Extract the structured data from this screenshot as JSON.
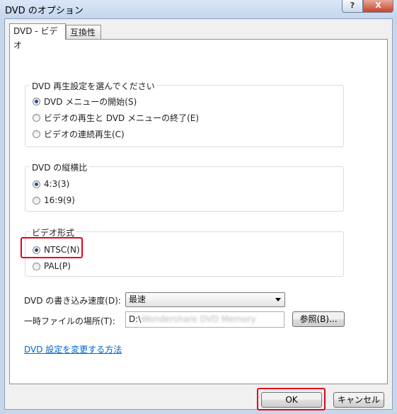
{
  "window": {
    "title": "DVD のオプション",
    "help_label": "?",
    "close_label": "X"
  },
  "tabs": [
    {
      "label": "DVD - ビデオ",
      "active": true
    },
    {
      "label": "互換性",
      "active": false
    }
  ],
  "playback_group": {
    "title": "DVD 再生設定を選んでください",
    "options": [
      {
        "label": "DVD メニューの開始(S)",
        "selected": true
      },
      {
        "label": "ビデオの再生と DVD メニューの終了(E)",
        "selected": false
      },
      {
        "label": "ビデオの連続再生(C)",
        "selected": false
      }
    ]
  },
  "aspect_group": {
    "title": "DVD の縦横比",
    "options": [
      {
        "label": "4:3(3)",
        "selected": true
      },
      {
        "label": "16:9(9)",
        "selected": false
      }
    ]
  },
  "format_group": {
    "title": "ビデオ形式",
    "options": [
      {
        "label": "NTSC(N)",
        "selected": true
      },
      {
        "label": "PAL(P)",
        "selected": false
      }
    ]
  },
  "burn_speed": {
    "label": "DVD の書き込み速度(D):",
    "value": "最速"
  },
  "temp_location": {
    "label": "一時ファイルの場所(T):",
    "value_prefix": "D:\\",
    "value_blurred": "Wondershare DVD Memory",
    "browse_label": "参照(B)..."
  },
  "settings_link": "DVD 設定を変更する方法",
  "footer": {
    "ok_label": "OK",
    "cancel_label": "キャンセル"
  },
  "colors": {
    "highlight": "#e8001c",
    "link": "#0066cc",
    "radio_dot": "#1f4f8f"
  }
}
